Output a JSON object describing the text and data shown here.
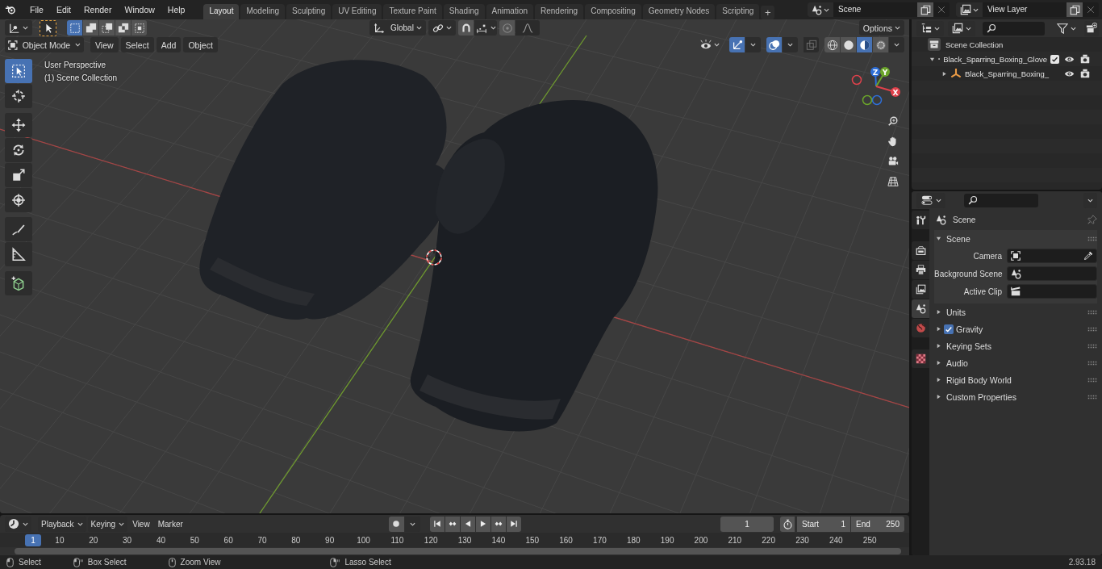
{
  "top_bar": {
    "menus": [
      "File",
      "Edit",
      "Render",
      "Window",
      "Help"
    ],
    "workspace_tabs": [
      {
        "label": "Layout",
        "selected": true
      },
      {
        "label": "Modeling",
        "selected": false
      },
      {
        "label": "Sculpting",
        "selected": false
      },
      {
        "label": "UV Editing",
        "selected": false
      },
      {
        "label": "Texture Paint",
        "selected": false
      },
      {
        "label": "Shading",
        "selected": false
      },
      {
        "label": "Animation",
        "selected": false
      },
      {
        "label": "Rendering",
        "selected": false
      },
      {
        "label": "Compositing",
        "selected": false
      },
      {
        "label": "Geometry Nodes",
        "selected": false
      },
      {
        "label": "Scripting",
        "selected": false
      }
    ],
    "add_tab": "+",
    "scene": "Scene",
    "view_layer": "View Layer"
  },
  "viewport": {
    "selection_modes": [
      {
        "kind": "set",
        "selected": true
      },
      {
        "kind": "extend",
        "selected": false
      },
      {
        "kind": "subtract",
        "selected": false
      },
      {
        "kind": "difference",
        "selected": false
      },
      {
        "kind": "intersect",
        "selected": false
      }
    ],
    "orientation": "Global",
    "options": "Options",
    "mode": "Object Mode",
    "menus": [
      "View",
      "Select",
      "Add",
      "Object"
    ],
    "toggles": [
      {
        "kind": "gizmos",
        "on": true
      },
      {
        "kind": "overlays",
        "on": true
      },
      {
        "kind": "xray",
        "on": false
      }
    ],
    "shading": [
      {
        "kind": "wireframe",
        "selected": false
      },
      {
        "kind": "solid",
        "selected": false
      },
      {
        "kind": "material",
        "selected": true
      },
      {
        "kind": "rendered",
        "selected": false
      }
    ],
    "info": [
      "User Perspective",
      "(1) Scene Collection"
    ],
    "tool_groups": [
      [
        {
          "kind": "select",
          "selected": true
        },
        {
          "kind": "cursor",
          "selected": false
        }
      ],
      [
        {
          "kind": "move",
          "selected": false
        },
        {
          "kind": "rotate",
          "selected": false
        },
        {
          "kind": "scale",
          "selected": false
        },
        {
          "kind": "transform",
          "selected": false
        }
      ],
      [
        {
          "kind": "annotate",
          "selected": false
        },
        {
          "kind": "measure",
          "selected": false
        }
      ],
      [
        {
          "kind": "add-cube",
          "selected": false
        }
      ]
    ],
    "gizmo_axes": [
      {
        "kind": "z",
        "label": "Z",
        "color": "#2e6fd8"
      },
      {
        "kind": "y",
        "label": "Y",
        "color": "#6ba52a"
      },
      {
        "kind": "x",
        "label": "X",
        "color": "#e0414b"
      }
    ]
  },
  "outliner": {
    "tree": [
      {
        "kind": "scene",
        "label": "Scene Collection",
        "children": [
          {
            "kind": "collection",
            "label": "Black_Sparring_Boxing_Glove",
            "expanded": true,
            "checked": true,
            "children": [
              {
                "kind": "empty",
                "label": "Black_Sparring_Boxing_",
                "expanded": false
              }
            ]
          }
        ]
      }
    ]
  },
  "properties": {
    "tabs": [
      {
        "kind": "tool",
        "selected": false
      },
      {
        "kind": "render",
        "selected": false
      },
      {
        "kind": "output",
        "selected": false
      },
      {
        "kind": "view-layer",
        "selected": false
      },
      {
        "kind": "scene",
        "selected": true
      },
      {
        "kind": "world",
        "selected": false
      },
      {
        "kind": "texture",
        "selected": false
      }
    ],
    "context": "Scene",
    "panels": [
      {
        "label": "Scene",
        "expanded": true,
        "fields": [
          {
            "kind": "object",
            "label": "Camera"
          },
          {
            "kind": "scene",
            "label": "Background Scene"
          },
          {
            "kind": "clip",
            "label": "Active Clip"
          }
        ]
      },
      {
        "label": "Units",
        "expanded": false
      },
      {
        "label": "Gravity",
        "expanded": false,
        "checked": true
      },
      {
        "label": "Keying Sets",
        "expanded": false
      },
      {
        "label": "Audio",
        "expanded": false
      },
      {
        "label": "Rigid Body World",
        "expanded": false
      },
      {
        "label": "Custom Properties",
        "expanded": false
      }
    ]
  },
  "timeline": {
    "menus": [
      {
        "label": "Playback",
        "dropdown": true
      },
      {
        "label": "Keying",
        "dropdown": true
      },
      {
        "label": "View",
        "dropdown": false
      },
      {
        "label": "Marker",
        "dropdown": false
      }
    ],
    "frame": "1",
    "start": {
      "label": "Start",
      "value": "1"
    },
    "end": {
      "label": "End",
      "value": "250"
    },
    "current": "1",
    "ruler": [
      "10",
      "20",
      "30",
      "40",
      "50",
      "60",
      "70",
      "80",
      "90",
      "100",
      "110",
      "120",
      "130",
      "140",
      "150",
      "160",
      "170",
      "180",
      "190",
      "200",
      "210",
      "220",
      "230",
      "240",
      "250"
    ]
  },
  "status_bar": {
    "hints": [
      {
        "kind": "left-click",
        "label": "Select"
      },
      {
        "kind": "left-drag",
        "label": "Box Select"
      },
      {
        "kind": "middle",
        "label": "Zoom View"
      },
      {
        "kind": "right-drag",
        "label": "Lasso Select"
      }
    ],
    "version": "2.93.18"
  }
}
